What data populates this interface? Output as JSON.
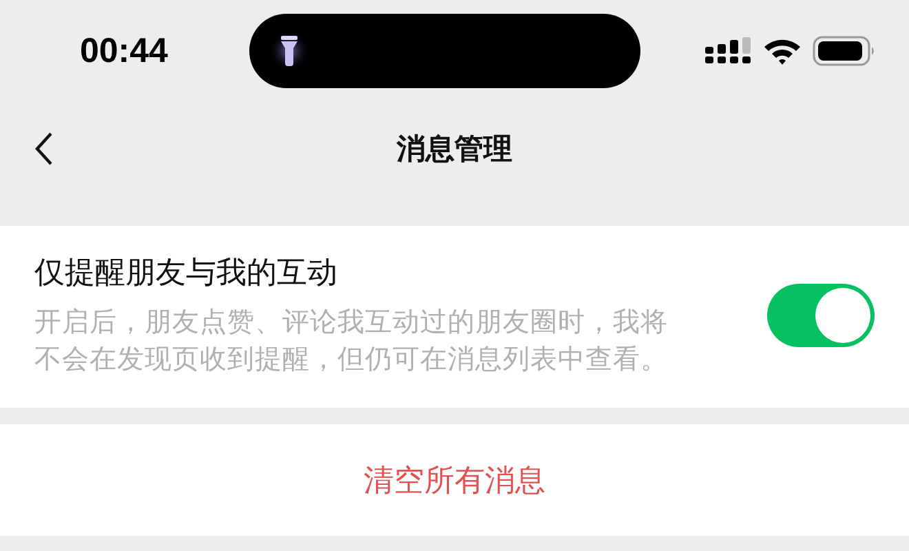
{
  "status_bar": {
    "time": "00:44"
  },
  "nav_bar": {
    "title": "消息管理"
  },
  "setting": {
    "title": "仅提醒朋友与我的互动",
    "description": "开启后，朋友点赞、评论我互动过的朋友圈时，我将不会在发现页收到提醒，但仍可在消息列表中查看。",
    "on": true
  },
  "action": {
    "label": "清空所有消息"
  }
}
